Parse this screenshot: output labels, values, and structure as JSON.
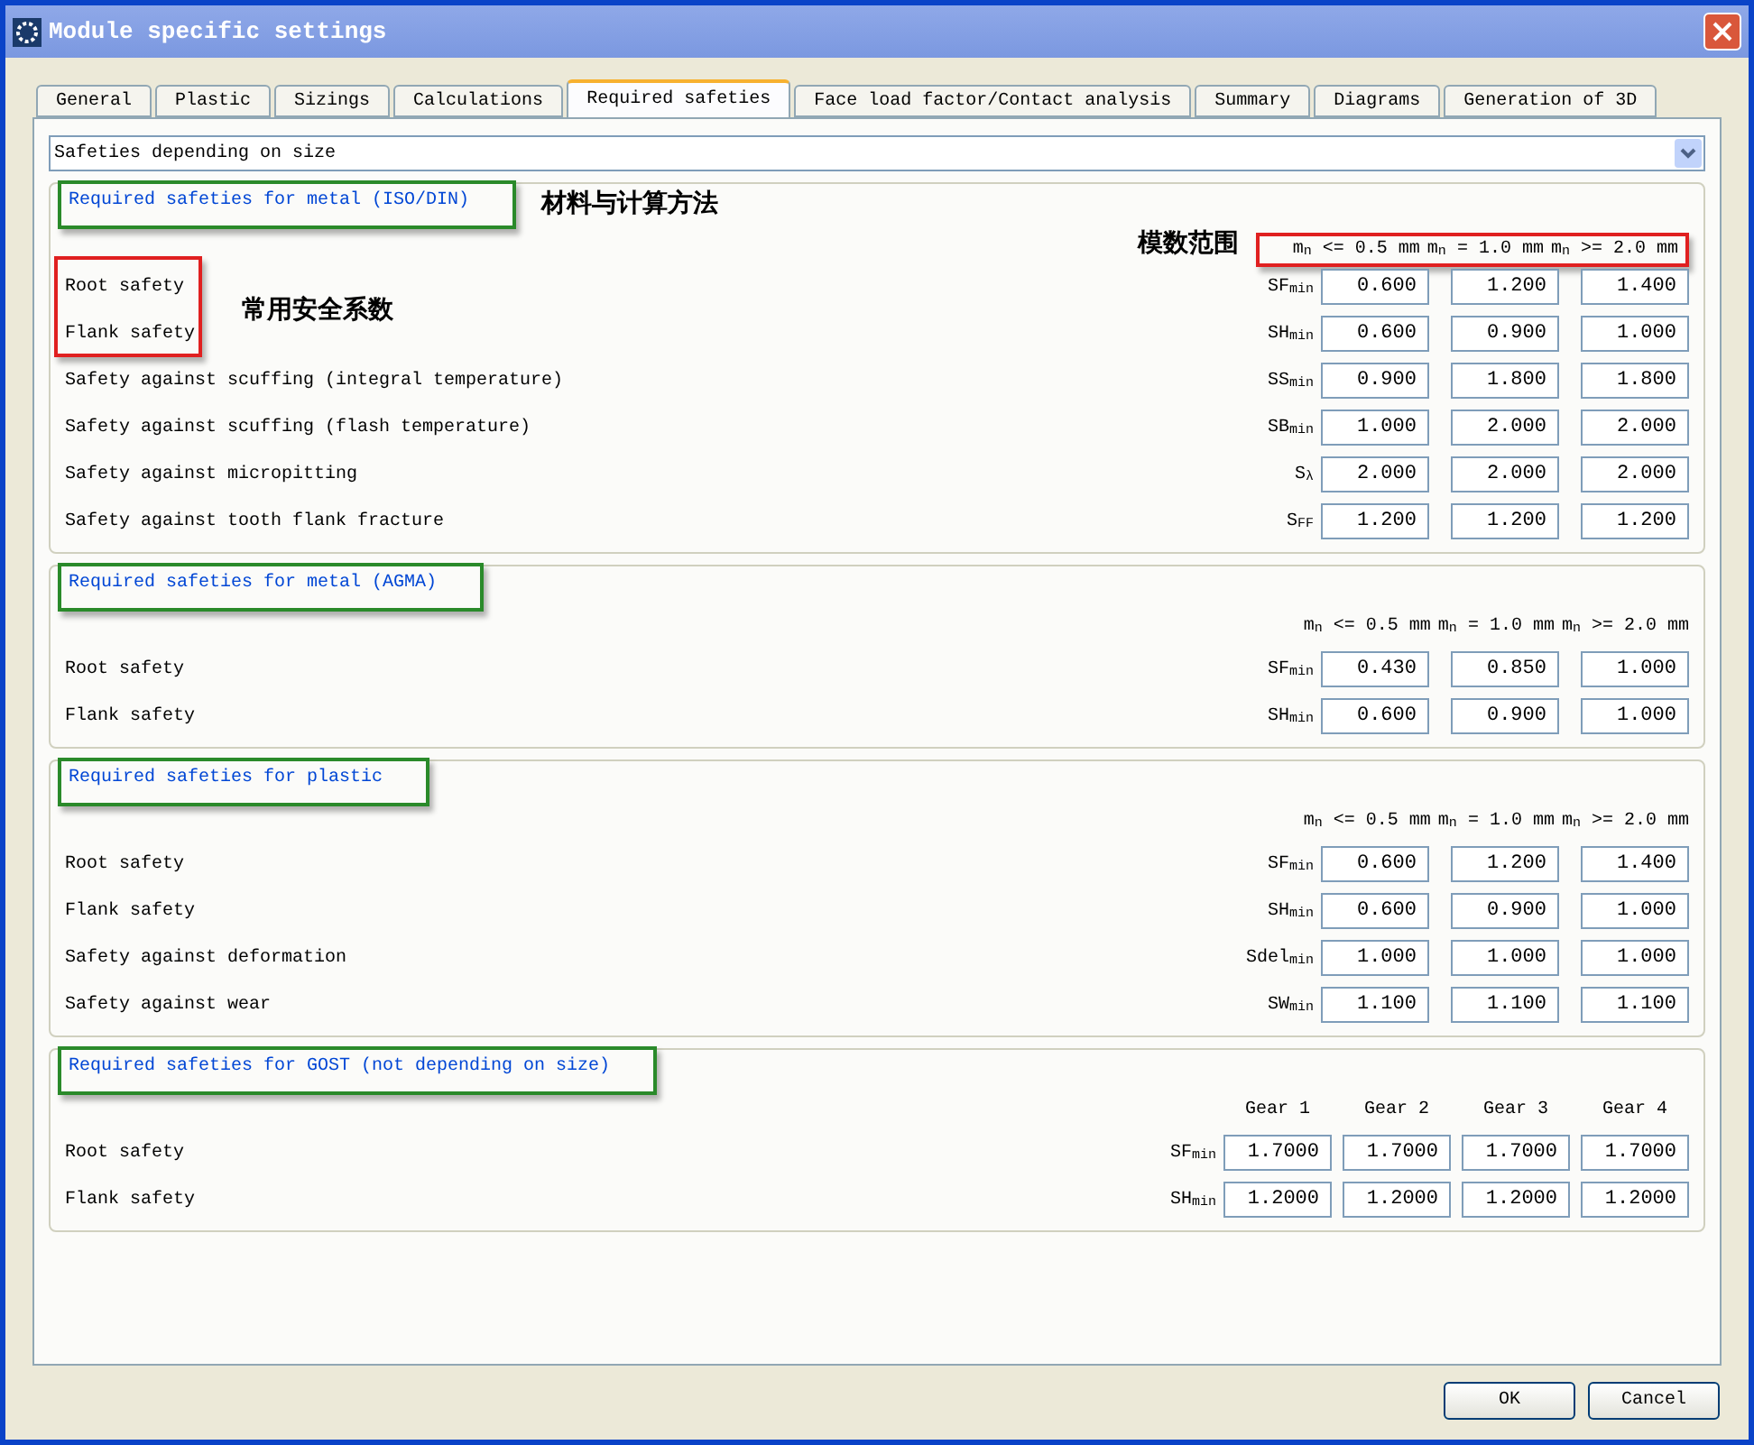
{
  "window": {
    "title": "Module specific settings"
  },
  "tabs": [
    {
      "label": "General",
      "selected": false
    },
    {
      "label": "Plastic",
      "selected": false
    },
    {
      "label": "Sizings",
      "selected": false
    },
    {
      "label": "Calculations",
      "selected": false
    },
    {
      "label": "Required safeties",
      "selected": true
    },
    {
      "label": "Face load factor/Contact analysis",
      "selected": false
    },
    {
      "label": "Summary",
      "selected": false
    },
    {
      "label": "Diagrams",
      "selected": false
    },
    {
      "label": "Generation of 3D",
      "selected": false
    }
  ],
  "dropdown": {
    "value": "Safeties depending on size"
  },
  "groups": [
    {
      "title": "Required safeties for metal (ISO/DIN)",
      "title_marked": true,
      "title_note": "材料与计算方法",
      "columns_marked": true,
      "columns_note": "模数范围",
      "rows_marked": true,
      "rows_note": "常用安全系数",
      "columns": [
        "m$_{n}$ <= 0.5 mm",
        "m$_{n}$ = 1.0 mm",
        "m$_{n}$ >= 2.0 mm"
      ],
      "rows": [
        {
          "label": "Root safety",
          "symbol": "SF$_{min}$",
          "values": [
            "0.600",
            "1.200",
            "1.400"
          ]
        },
        {
          "label": "Flank safety",
          "symbol": "SH$_{min}$",
          "values": [
            "0.600",
            "0.900",
            "1.000"
          ]
        },
        {
          "label": "Safety against scuffing (integral temperature)",
          "symbol": "SS$_{min}$",
          "values": [
            "0.900",
            "1.800",
            "1.800"
          ]
        },
        {
          "label": "Safety against scuffing (flash temperature)",
          "symbol": "SB$_{min}$",
          "values": [
            "1.000",
            "2.000",
            "2.000"
          ]
        },
        {
          "label": "Safety against micropitting",
          "symbol": "S$_{λ}$",
          "values": [
            "2.000",
            "2.000",
            "2.000"
          ]
        },
        {
          "label": "Safety against tooth flank fracture",
          "symbol": "S$_{FF}$",
          "values": [
            "1.200",
            "1.200",
            "1.200"
          ]
        }
      ]
    },
    {
      "title": "Required safeties for metal (AGMA)",
      "title_marked": true,
      "columns": [
        "m$_{n}$ <= 0.5 mm",
        "m$_{n}$ = 1.0 mm",
        "m$_{n}$ >= 2.0 mm"
      ],
      "rows": [
        {
          "label": "Root safety",
          "symbol": "SF$_{min}$",
          "values": [
            "0.430",
            "0.850",
            "1.000"
          ]
        },
        {
          "label": "Flank safety",
          "symbol": "SH$_{min}$",
          "values": [
            "0.600",
            "0.900",
            "1.000"
          ]
        }
      ]
    },
    {
      "title": "Required safeties for plastic",
      "title_marked": true,
      "columns": [
        "m$_{n}$ <= 0.5 mm",
        "m$_{n}$ = 1.0 mm",
        "m$_{n}$ >= 2.0 mm"
      ],
      "rows": [
        {
          "label": "Root safety",
          "symbol": "SF$_{min}$",
          "values": [
            "0.600",
            "1.200",
            "1.400"
          ]
        },
        {
          "label": "Flank safety",
          "symbol": "SH$_{min}$",
          "values": [
            "0.600",
            "0.900",
            "1.000"
          ]
        },
        {
          "label": "Safety against deformation",
          "symbol": "Sdel$_{min}$",
          "values": [
            "1.000",
            "1.000",
            "1.000"
          ]
        },
        {
          "label": "Safety against wear",
          "symbol": "SW$_{min}$",
          "values": [
            "1.100",
            "1.100",
            "1.100"
          ]
        }
      ]
    },
    {
      "title": "Required safeties for GOST (not depending on size)",
      "title_marked": true,
      "columns": [
        "Gear 1",
        "Gear 2",
        "Gear 3",
        "Gear 4"
      ],
      "rows": [
        {
          "label": "Root safety",
          "symbol": "SF$_{min}$",
          "values": [
            "1.7000",
            "1.7000",
            "1.7000",
            "1.7000"
          ]
        },
        {
          "label": "Flank safety",
          "symbol": "SH$_{min}$",
          "values": [
            "1.2000",
            "1.2000",
            "1.2000",
            "1.2000"
          ]
        }
      ]
    }
  ],
  "buttons": [
    "OK",
    "Cancel"
  ]
}
